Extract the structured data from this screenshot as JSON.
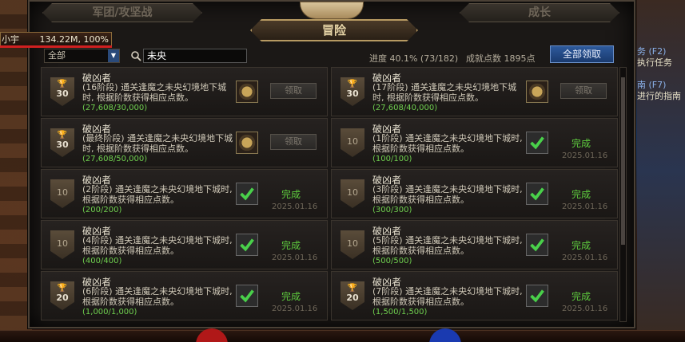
{
  "window": {
    "tabs": {
      "left": "军团/攻坚战",
      "right": "成长",
      "active": "冒险"
    }
  },
  "filter": {
    "selected": "全部"
  },
  "search": {
    "value": "未央"
  },
  "summary": {
    "progress": "进度 40.1% (73/182)",
    "points": "成就点数 1895点",
    "claim_all": "全部领取"
  },
  "player": {
    "name": "小宇",
    "hp": "134.22M, 100%"
  },
  "side_hud": {
    "line1_key": "务 (F2)",
    "line1": "执行任务",
    "line2_key": "南 (F7)",
    "line2": "进行的指南"
  },
  "achievements": [
    {
      "badge_icon": "trophy-icon",
      "points": "30",
      "title": "破凶者",
      "desc": "(16阶段) 通关逢魔之未央幻境地下城时, 根据阶数获得相应点数。",
      "progress": "(27,608/30,000)",
      "status": "claim",
      "claim_label": "领取",
      "date": ""
    },
    {
      "badge_icon": "trophy-icon",
      "points": "30",
      "title": "破凶者",
      "desc": "(17阶段) 通关逢魔之未央幻境地下城时, 根据阶数获得相应点数。",
      "progress": "(27,608/40,000)",
      "status": "claim",
      "claim_label": "领取",
      "date": ""
    },
    {
      "badge_icon": "trophy-icon",
      "points": "30",
      "title": "破凶者",
      "desc": "(最终阶段) 通关逢魔之未央幻境地下城时, 根据阶数获得相应点数。",
      "progress": "(27,608/50,000)",
      "status": "claim",
      "claim_label": "领取",
      "date": ""
    },
    {
      "badge_icon": "",
      "points": "10",
      "title": "破凶者",
      "desc": "(1阶段) 通关逢魔之未央幻境地下城时, 根据阶数获得相应点数。",
      "progress": "(100/100)",
      "status": "done",
      "claim_label": "完成",
      "date": "2025.01.16"
    },
    {
      "badge_icon": "",
      "points": "10",
      "title": "破凶者",
      "desc": "(2阶段) 通关逢魔之未央幻境地下城时, 根据阶数获得相应点数。",
      "progress": "(200/200)",
      "status": "done",
      "claim_label": "完成",
      "date": "2025.01.16"
    },
    {
      "badge_icon": "",
      "points": "10",
      "title": "破凶者",
      "desc": "(3阶段) 通关逢魔之未央幻境地下城时, 根据阶数获得相应点数。",
      "progress": "(300/300)",
      "status": "done",
      "claim_label": "完成",
      "date": "2025.01.16"
    },
    {
      "badge_icon": "",
      "points": "10",
      "title": "破凶者",
      "desc": "(4阶段) 通关逢魔之未央幻境地下城时, 根据阶数获得相应点数。",
      "progress": "(400/400)",
      "status": "done",
      "claim_label": "完成",
      "date": "2025.01.16"
    },
    {
      "badge_icon": "",
      "points": "10",
      "title": "破凶者",
      "desc": "(5阶段) 通关逢魔之未央幻境地下城时, 根据阶数获得相应点数。",
      "progress": "(500/500)",
      "status": "done",
      "claim_label": "完成",
      "date": "2025.01.16"
    },
    {
      "badge_icon": "trophy-icon",
      "points": "20",
      "title": "破凶者",
      "desc": "(6阶段) 通关逢魔之未央幻境地下城时, 根据阶数获得相应点数。",
      "progress": "(1,000/1,000)",
      "status": "done",
      "claim_label": "完成",
      "date": "2025.01.16"
    },
    {
      "badge_icon": "trophy-icon",
      "points": "20",
      "title": "破凶者",
      "desc": "(7阶段) 通关逢魔之未央幻境地下城时, 根据阶数获得相应点数。",
      "progress": "(1,500/1,500)",
      "status": "done",
      "claim_label": "完成",
      "date": "2025.01.16"
    }
  ],
  "colors": {
    "done": "#5fcf3f",
    "accent": "#2e5a9c",
    "gold": "#b79a62"
  }
}
